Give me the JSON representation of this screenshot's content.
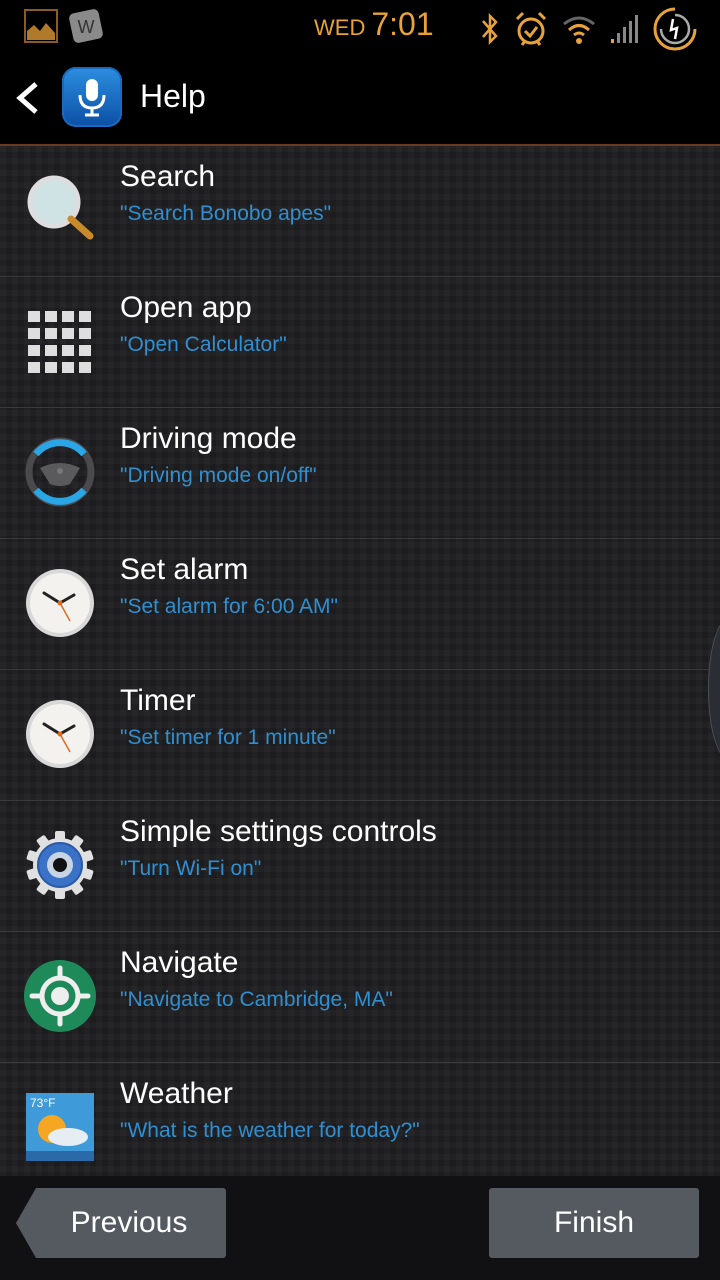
{
  "status_bar": {
    "day": "WED",
    "time": "7:01",
    "notification_icons": [
      "gallery-icon",
      "w-app-icon"
    ],
    "system_icons": [
      "bluetooth-icon",
      "alarm-icon",
      "wifi-icon",
      "signal-icon",
      "battery-charging-icon"
    ],
    "accent_color": "#e8a23a"
  },
  "action_bar": {
    "title": "Help",
    "app_icon": "voice-microphone-icon"
  },
  "commands": [
    {
      "label": "Search",
      "example": "\"Search Bonobo apes\"",
      "icon": "magnifier-icon"
    },
    {
      "label": "Open app",
      "example": "\"Open Calculator\"",
      "icon": "app-grid-icon"
    },
    {
      "label": "Driving mode",
      "example": "\"Driving mode on/off\"",
      "icon": "steering-wheel-icon"
    },
    {
      "label": "Set alarm",
      "example": "\"Set alarm for 6:00 AM\"",
      "icon": "clock-icon"
    },
    {
      "label": "Timer",
      "example": "\"Set timer for 1 minute\"",
      "icon": "clock-icon"
    },
    {
      "label": "Simple settings controls",
      "example": "\"Turn Wi-Fi on\"",
      "icon": "settings-gear-icon"
    },
    {
      "label": "Navigate",
      "example": "\"Navigate to Cambridge, MA\"",
      "icon": "navigate-target-icon"
    },
    {
      "label": "Weather",
      "example": "\"What is the weather for today?\"",
      "icon": "weather-icon",
      "icon_temp": "73°F"
    }
  ],
  "footer": {
    "previous_label": "Previous",
    "finish_label": "Finish"
  },
  "colors": {
    "example_text": "#2f8fd0",
    "button_bg": "#555a60"
  }
}
